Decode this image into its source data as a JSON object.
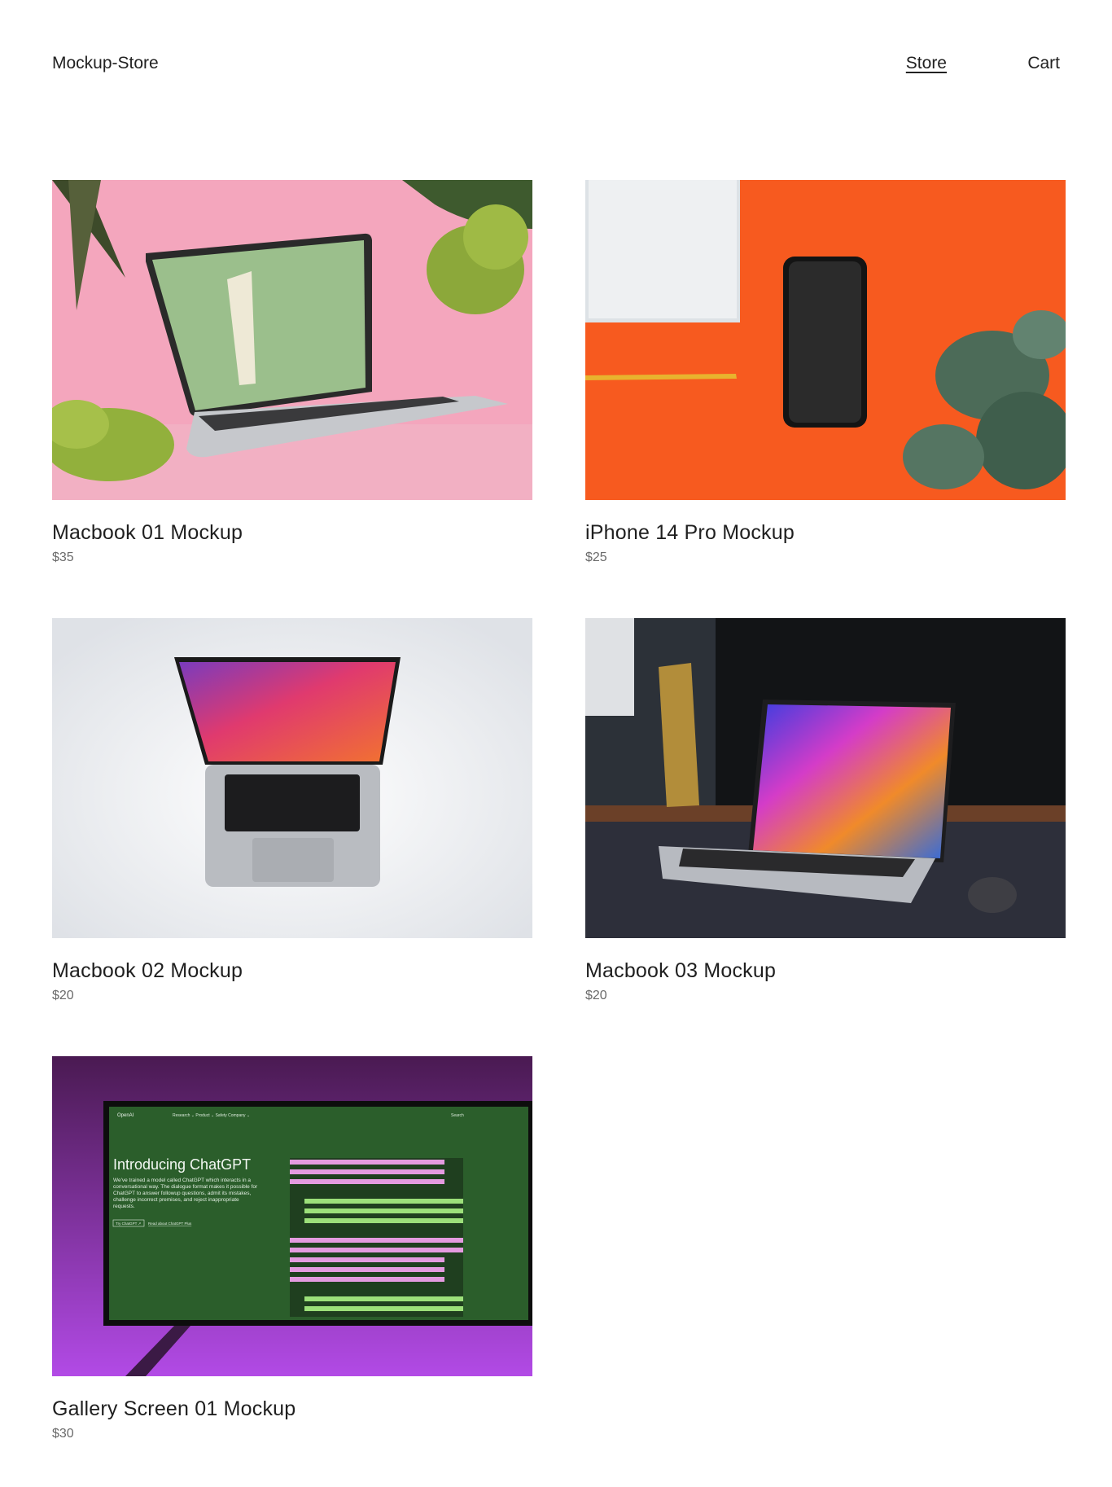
{
  "header": {
    "brand": "Mockup-Store",
    "nav": {
      "store": "Store",
      "cart": "Cart"
    }
  },
  "products": [
    {
      "title": "Macbook 01 Mockup",
      "price": "$35"
    },
    {
      "title": "iPhone 14 Pro Mockup",
      "price": "$25"
    },
    {
      "title": "Macbook 02 Mockup",
      "price": "$20"
    },
    {
      "title": "Macbook 03 Mockup",
      "price": "$20"
    },
    {
      "title": "Gallery Screen 01 Mockup",
      "price": "$30"
    }
  ],
  "screen_content": {
    "logo": "OpenAI",
    "menu": "Research ⌄   Product ⌄   Safety   Company ⌄",
    "search": "Search",
    "headline": "Introducing ChatGPT",
    "body": [
      "We've trained a model called ChatGPT which interacts in a",
      "conversational way. The dialogue format makes it possible for",
      "ChatGPT to answer followup questions, admit its mistakes,",
      "challenge incorrect premises, and reject inappropriate",
      "requests."
    ],
    "cta_primary": "Try ChatGPT ↗",
    "cta_secondary": "Read about ChatGPT Plus"
  },
  "colors": {
    "text": "#1f1f1f",
    "muted": "#6a6a6a",
    "background": "#ffffff"
  }
}
